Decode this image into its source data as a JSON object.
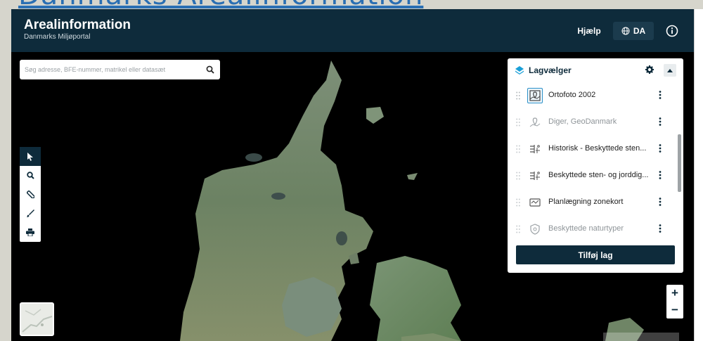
{
  "page_heading": "Danmarks Arealinformation",
  "header": {
    "title": "Arealinformation",
    "subtitle": "Danmarks Miljøportal",
    "help_label": "Hjælp",
    "language_label": "DA"
  },
  "search": {
    "placeholder": "Søg adresse, BFE-nummer, matrikel eller datasæt"
  },
  "layer_panel": {
    "title": "Lagvælger",
    "add_label": "Tilføj lag",
    "layers": [
      {
        "label": "Ortofoto 2002"
      },
      {
        "label": "Diger, GeoDanmark"
      },
      {
        "label": "Historisk - Beskyttede sten..."
      },
      {
        "label": "Beskyttede sten- og jorddig..."
      },
      {
        "label": "Planlægning zonekort"
      },
      {
        "label": "Beskyttede naturtyper"
      }
    ]
  },
  "zoom": {
    "in_label": "+",
    "out_label": "−"
  },
  "colors": {
    "header": "#0e2b3b",
    "accent": "#2a8fc7",
    "land": "#6f8566"
  }
}
